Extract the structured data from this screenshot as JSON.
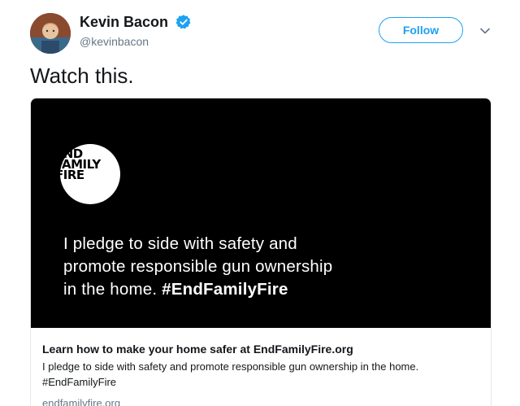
{
  "author": {
    "display_name": "Kevin Bacon",
    "username": "@kevinbacon",
    "verified": true
  },
  "actions": {
    "follow_label": "Follow"
  },
  "tweet": {
    "text": "Watch this."
  },
  "card": {
    "media": {
      "logo_lines": [
        "END",
        "FAMILY",
        "FIRE"
      ],
      "lines": [
        "I pledge to side with safety and",
        "promote responsible gun ownership"
      ],
      "line3_prefix": "in the home. ",
      "hashtag": "#EndFamilyFire"
    },
    "title": "Learn how to make your home safer at EndFamilyFire.org",
    "description_lines": [
      "I pledge to side with safety and promote responsible gun ownership in the home.",
      "#EndFamilyFire"
    ],
    "domain": "endfamilyfire.org"
  },
  "colors": {
    "accent": "#1da1f2",
    "text_primary": "#14171a",
    "text_secondary": "#657786",
    "border": "#e1e8ed",
    "media_background": "#000000"
  },
  "icons": {
    "verified": "verified-badge-icon",
    "more": "chevron-down-icon"
  }
}
